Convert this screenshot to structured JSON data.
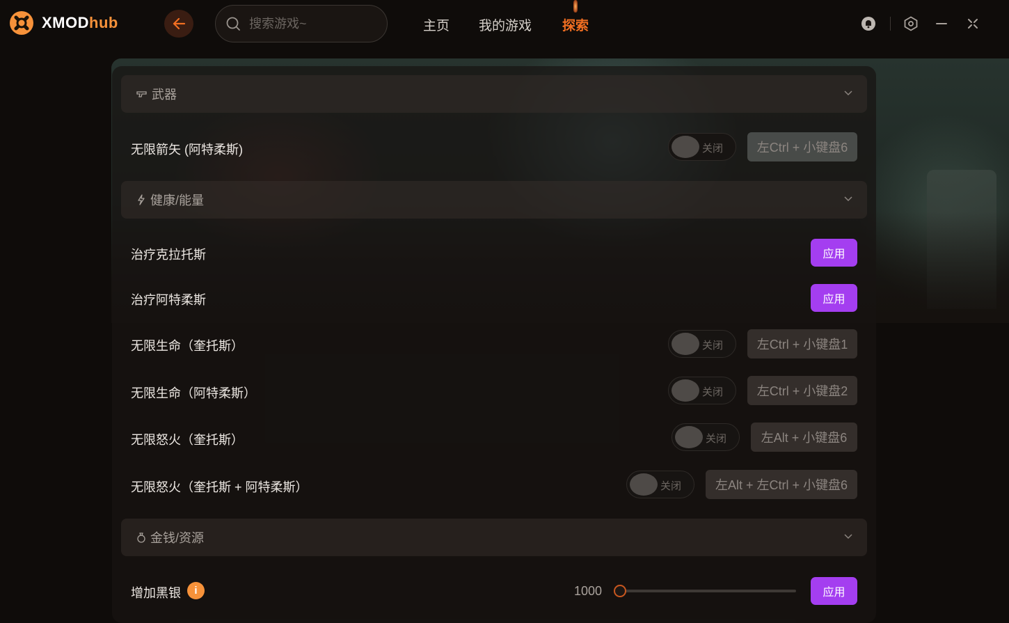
{
  "app": {
    "logo_main": "XMOD",
    "logo_accent": "hub",
    "accent_color": "#f26f22",
    "apply_color": "#a43ef0"
  },
  "search": {
    "placeholder": "搜索游戏~"
  },
  "nav": {
    "home": "主页",
    "my_games": "我的游戏",
    "explore": "探索",
    "active": "explore"
  },
  "sections": {
    "weapons": {
      "title": "武器"
    },
    "health": {
      "title": "健康/能量"
    },
    "money": {
      "title": "金钱/资源"
    }
  },
  "rows": {
    "r1": {
      "label": "无限箭矢 (阿特柔斯)",
      "toggle": "关闭",
      "hotkey": "左Ctrl + 小键盘6"
    },
    "r2": {
      "label": "治疗克拉托斯",
      "button": "应用"
    },
    "r3": {
      "label": "治疗阿特柔斯",
      "button": "应用"
    },
    "r4": {
      "label": "无限生命（奎托斯）",
      "toggle": "关闭",
      "hotkey": "左Ctrl + 小键盘1"
    },
    "r5": {
      "label": "无限生命（阿特柔斯）",
      "toggle": "关闭",
      "hotkey": "左Ctrl + 小键盘2"
    },
    "r6": {
      "label": "无限怒火（奎托斯）",
      "toggle": "关闭",
      "hotkey": "左Alt + 小键盘6"
    },
    "r7": {
      "label": "无限怒火（奎托斯 + 阿特柔斯）",
      "toggle": "关闭",
      "hotkey": "左Alt + 左Ctrl + 小键盘6"
    },
    "r8": {
      "label": "增加黑银",
      "info": "i",
      "value": "1000",
      "slider_fraction": 0.0,
      "button": "应用"
    }
  }
}
